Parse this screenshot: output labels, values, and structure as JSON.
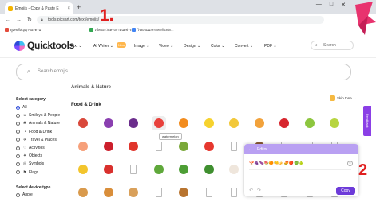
{
  "browser": {
    "tab_title": "Emojis  - Copy & Paste E",
    "tab_close": "×",
    "new_tab": "+",
    "window_controls": [
      "—",
      "□",
      "✕"
    ],
    "nav_back": "←",
    "nav_forward": "→",
    "nav_reload": "↻",
    "url": "tools.picsart.com/text/emojis/",
    "bookmarks": [
      {
        "label": "ดูเลขที่สัญญาของท่าน",
        "color": "#e34b3b"
      },
      {
        "label": "เช็คจองวันครบกำหนดชำระ...",
        "color": "#34a853"
      },
      {
        "label": "โรงแรมและราคาห้องพัก...",
        "color": "#4285f4"
      }
    ]
  },
  "site": {
    "logo_text": "Quicktools",
    "logo_sub": "By Picsart",
    "menu": [
      "Text ⌄",
      "AI Writer ⌄",
      "Image ⌄",
      "Video ⌄",
      "Design ⌄",
      "Color ⌄",
      "Convert ⌄",
      "PDF ⌄"
    ],
    "new_badge": "New",
    "search_placeholder": "Search",
    "search_icon": "⌕"
  },
  "emoji_search": {
    "placeholder": "Search emojis...",
    "icon": "⌕"
  },
  "section_top": "Animals & Nature",
  "section": "Food & Drink",
  "skin_tone_label": "Skin tone",
  "sidebar": {
    "title": "Select category",
    "categories": [
      {
        "label": "All",
        "icon": "",
        "selected": true
      },
      {
        "label": "Smileys & People",
        "icon": "☺",
        "selected": false
      },
      {
        "label": "Animals & Nature",
        "icon": "❀",
        "selected": false
      },
      {
        "label": "Food & Drink",
        "icon": "◔",
        "selected": false
      },
      {
        "label": "Travel & Places",
        "icon": "✈",
        "selected": false
      },
      {
        "label": "Activities",
        "icon": "♡",
        "selected": false
      },
      {
        "label": "Objects",
        "icon": "✦",
        "selected": false
      },
      {
        "label": "Symbols",
        "icon": "◎",
        "selected": false
      },
      {
        "label": "Flags",
        "icon": "⚑",
        "selected": false
      }
    ],
    "device_title": "Select device type",
    "device_first": "Apple"
  },
  "emoji_grid": [
    [
      {
        "name": "mushroom",
        "color": "#d9483b"
      },
      {
        "name": "grapes",
        "color": "#8a3fb0"
      },
      {
        "name": "eggplant",
        "color": "#6b2d8c"
      },
      {
        "name": "watermelon",
        "color": "#e8413c",
        "hover": true
      },
      {
        "name": "tangerine",
        "color": "#f28c1e"
      },
      {
        "name": "lemon",
        "color": "#f6d22e"
      },
      {
        "name": "banana",
        "color": "#f2c83a"
      },
      {
        "name": "mango",
        "color": "#f2a23b"
      },
      {
        "name": "red-apple",
        "color": "#d7262e"
      },
      {
        "name": "green-apple",
        "color": "#8dc63f"
      },
      {
        "name": "pear",
        "color": "#b7d540"
      }
    ],
    [
      {
        "name": "peach",
        "color": "#f6a07a"
      },
      {
        "name": "cherries",
        "color": "#cc1f2c"
      },
      {
        "name": "strawberry",
        "color": "#e0342b"
      },
      {
        "name": "missing",
        "color": ""
      },
      {
        "name": "kiwi",
        "color": "#7aa839"
      },
      {
        "name": "tomato",
        "color": "#e6382f"
      },
      {
        "name": "missing",
        "color": ""
      },
      {
        "name": "coconut",
        "color": "#8a5a35"
      },
      {
        "name": "missing",
        "color": ""
      },
      {
        "name": "missing",
        "color": ""
      },
      {
        "name": "missing",
        "color": ""
      }
    ],
    [
      {
        "name": "corn",
        "color": "#f3c52c"
      },
      {
        "name": "hot-pepper",
        "color": "#d9302d"
      },
      {
        "name": "missing",
        "color": ""
      },
      {
        "name": "cucumber",
        "color": "#5fa83a"
      },
      {
        "name": "leafy-green",
        "color": "#4d9e35"
      },
      {
        "name": "broccoli",
        "color": "#3f8f2f"
      },
      {
        "name": "garlic",
        "color": "#efe6dc"
      },
      {
        "name": "missing",
        "color": ""
      },
      {
        "name": "missing",
        "color": ""
      },
      {
        "name": "missing",
        "color": ""
      },
      {
        "name": "missing",
        "color": ""
      }
    ],
    [
      {
        "name": "bread",
        "color": "#d99a4c"
      },
      {
        "name": "croissant",
        "color": "#d98e3a"
      },
      {
        "name": "baguette",
        "color": "#d9a05a"
      },
      {
        "name": "missing",
        "color": ""
      },
      {
        "name": "pretzel",
        "color": "#b8742f"
      },
      {
        "name": "missing",
        "color": ""
      },
      {
        "name": "missing",
        "color": ""
      },
      {
        "name": "missing",
        "color": ""
      },
      {
        "name": "missing",
        "color": ""
      },
      {
        "name": "missing",
        "color": ""
      },
      {
        "name": "missing",
        "color": ""
      }
    ]
  ],
  "tooltip": "watermelon",
  "editor": {
    "title": "Editor",
    "back": "←",
    "content": "🍄🍇🍆🍉🍊🍋🍌🥭🍎🍏🍐",
    "clear": "×",
    "undo": "↶",
    "redo": "↷",
    "copy_label": "Copy"
  },
  "feedback_label": "Feedback",
  "annotations": {
    "step1": "1.",
    "step2": "2"
  },
  "colors": {
    "accent": "#6d3bd9",
    "annotation": "#e02020",
    "brand": "#2d4bd8"
  }
}
